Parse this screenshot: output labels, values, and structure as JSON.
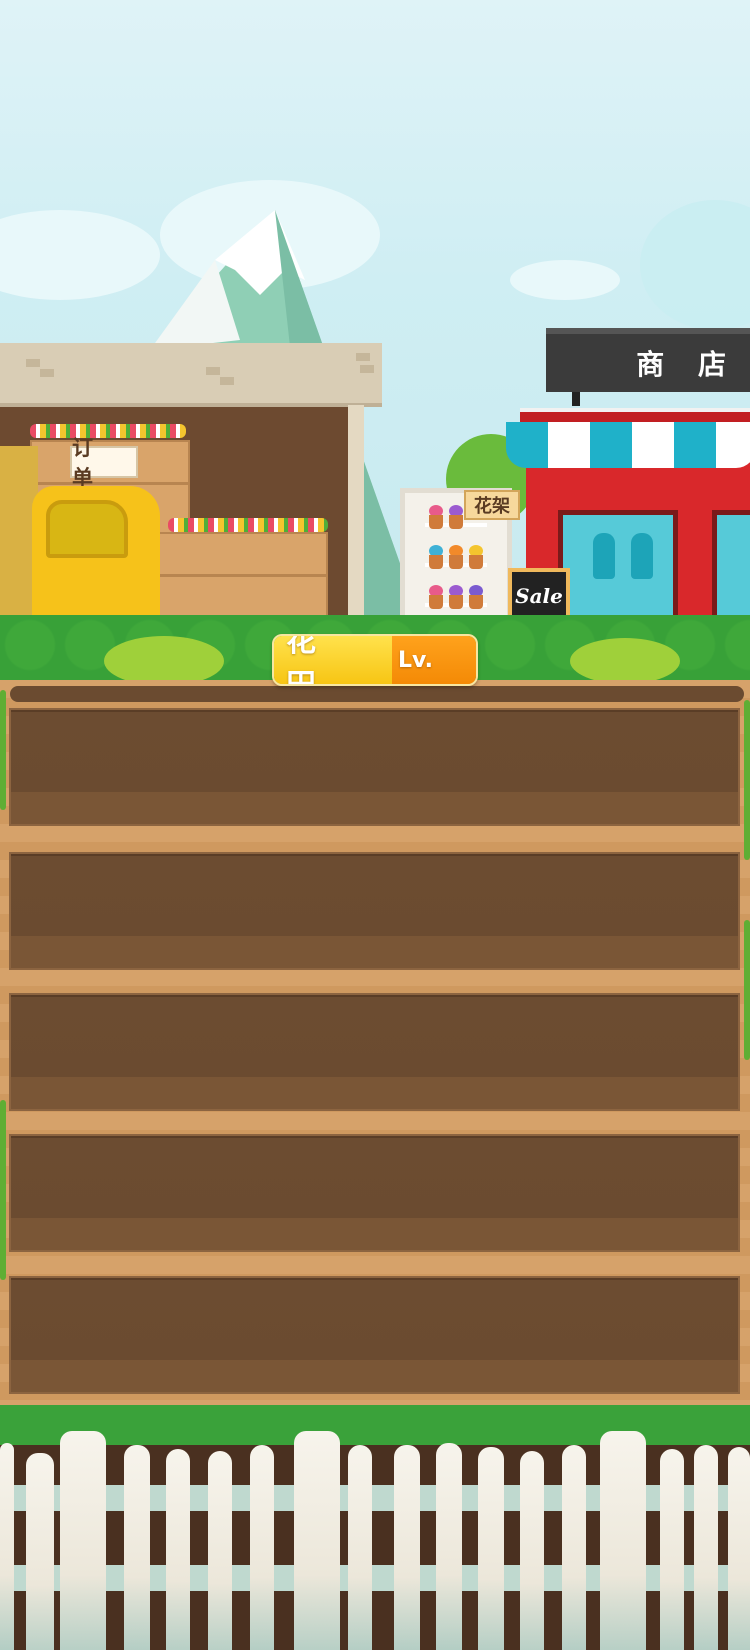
{
  "scene": {
    "order_sign": "订 单",
    "shelf_sign": "花架",
    "shop_sign": "商 店",
    "sale_board": "Sale"
  },
  "banner": {
    "title": "花 田",
    "level_label": "Lv."
  },
  "plots": [
    {
      "id": "plot-1"
    },
    {
      "id": "plot-2"
    },
    {
      "id": "plot-3"
    },
    {
      "id": "plot-4"
    },
    {
      "id": "plot-5"
    }
  ],
  "colors": {
    "soil": "#6b4b30",
    "wood": "#d6a26a",
    "banner_yellow": "#f7c514",
    "banner_orange": "#f48a06",
    "shop_red": "#d9282b",
    "awning_teal": "#1fb1c9"
  }
}
